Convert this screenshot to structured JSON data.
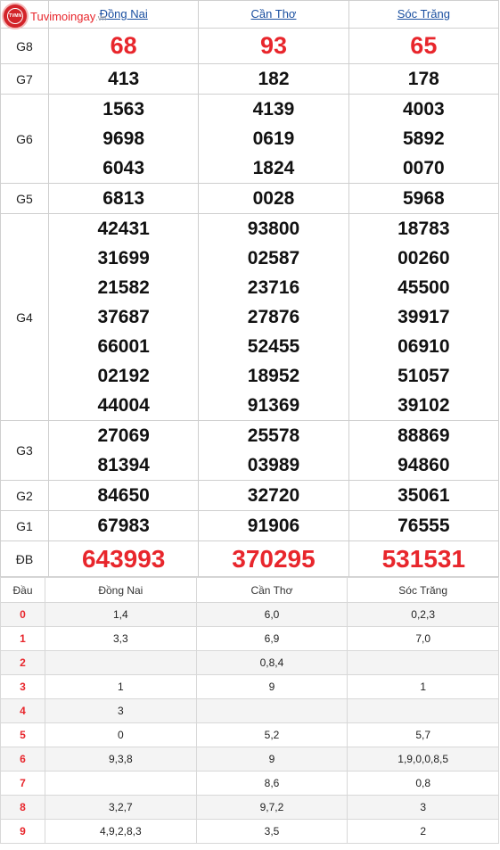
{
  "logo": {
    "text": "Tuvimoingay",
    "suffix": ".vn",
    "badge": "TVMN"
  },
  "provinces": [
    "Đồng Nai",
    "Cần Thơ",
    "Sóc Trăng"
  ],
  "prizes": [
    {
      "label": "G8",
      "rows": [
        [
          "68",
          "93",
          "65"
        ]
      ],
      "red": true,
      "size": 27
    },
    {
      "label": "G7",
      "rows": [
        [
          "413",
          "182",
          "178"
        ]
      ]
    },
    {
      "label": "G6",
      "rows": [
        [
          "1563",
          "4139",
          "4003"
        ],
        [
          "9698",
          "0619",
          "5892"
        ],
        [
          "6043",
          "1824",
          "0070"
        ]
      ]
    },
    {
      "label": "G5",
      "rows": [
        [
          "6813",
          "0028",
          "5968"
        ]
      ]
    },
    {
      "label": "G4",
      "rows": [
        [
          "42431",
          "93800",
          "18783"
        ],
        [
          "31699",
          "02587",
          "00260"
        ],
        [
          "21582",
          "23716",
          "45500"
        ],
        [
          "37687",
          "27876",
          "39917"
        ],
        [
          "66001",
          "52455",
          "06910"
        ],
        [
          "02192",
          "18952",
          "51057"
        ],
        [
          "44004",
          "91369",
          "39102"
        ]
      ]
    },
    {
      "label": "G3",
      "rows": [
        [
          "27069",
          "25578",
          "88869"
        ],
        [
          "81394",
          "03989",
          "94860"
        ]
      ]
    },
    {
      "label": "G2",
      "rows": [
        [
          "84650",
          "32720",
          "35061"
        ]
      ]
    },
    {
      "label": "G1",
      "rows": [
        [
          "67983",
          "91906",
          "76555"
        ]
      ]
    },
    {
      "label": "ĐB",
      "rows": [
        [
          "643993",
          "370295",
          "531531"
        ]
      ],
      "red": true,
      "size": 28
    }
  ],
  "dau_table": {
    "header": [
      "Đầu",
      "Đồng Nai",
      "Cần Thơ",
      "Sóc Trăng"
    ],
    "rows": [
      [
        "0",
        "1,4",
        "6,0",
        "0,2,3"
      ],
      [
        "1",
        "3,3",
        "6,9",
        "7,0"
      ],
      [
        "2",
        "",
        "0,8,4",
        ""
      ],
      [
        "3",
        "1",
        "9",
        "1"
      ],
      [
        "4",
        "3",
        "",
        ""
      ],
      [
        "5",
        "0",
        "5,2",
        "5,7"
      ],
      [
        "6",
        "9,3,8",
        "9",
        "1,9,0,0,8,5"
      ],
      [
        "7",
        "",
        "8,6",
        "0,8"
      ],
      [
        "8",
        "3,2,7",
        "9,7,2",
        "3"
      ],
      [
        "9",
        "4,9,2,8,3",
        "3,5",
        "2"
      ]
    ]
  },
  "colors": {
    "accent_red": "#e8262c",
    "link_blue": "#1a4fa0"
  }
}
